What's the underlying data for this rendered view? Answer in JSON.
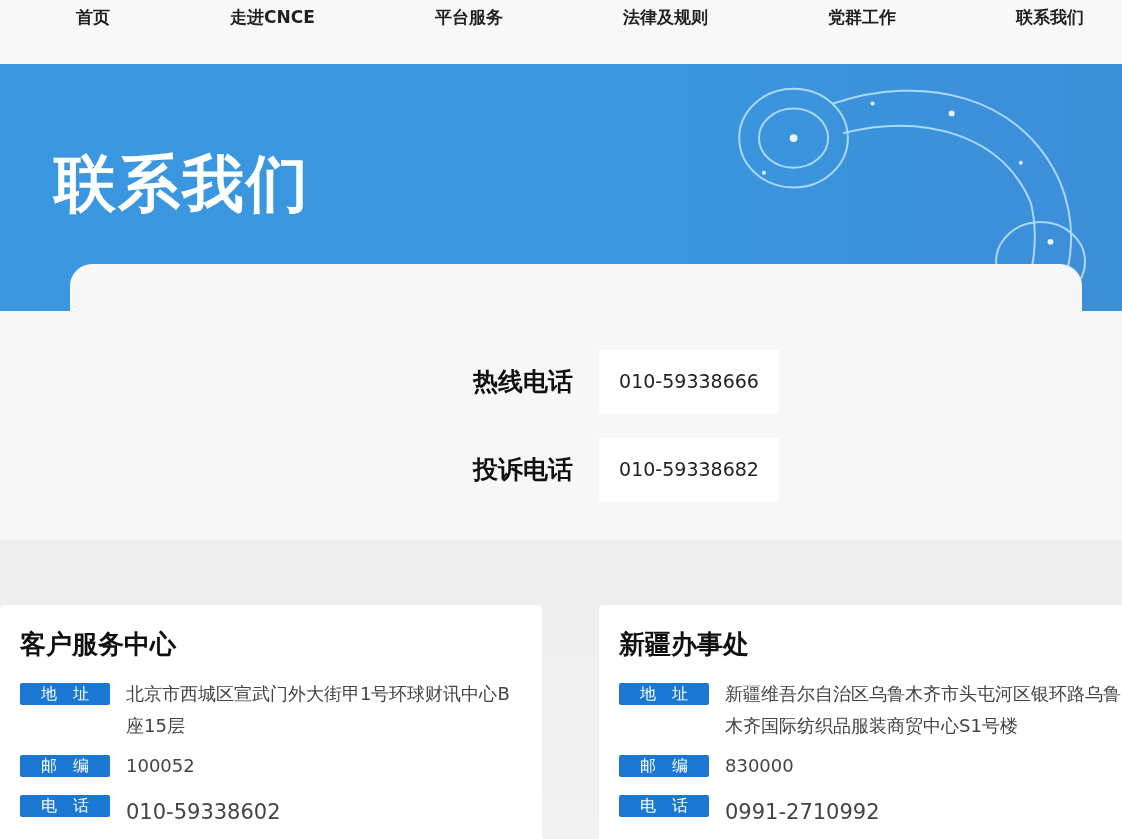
{
  "nav": [
    {
      "label": "首页"
    },
    {
      "label": "走进CNCE"
    },
    {
      "label": "平台服务"
    },
    {
      "label": "法律及规则"
    },
    {
      "label": "党群工作"
    },
    {
      "label": "联系我们"
    }
  ],
  "banner": {
    "title": "联系我们"
  },
  "hotlines": [
    {
      "label": "热线电话",
      "number": "010-59338666"
    },
    {
      "label": "投诉电话",
      "number": "010-59338682"
    }
  ],
  "offices": [
    {
      "name": "客户服务中心",
      "fields": [
        {
          "label": "地址",
          "value": "北京市西城区宣武门外大街甲1号环球财讯中心B座15层"
        },
        {
          "label": "邮编",
          "value": "100052"
        },
        {
          "label": "电话",
          "value": "010-59338602"
        }
      ]
    },
    {
      "name": "新疆办事处",
      "fields": [
        {
          "label": "地址",
          "value": "新疆维吾尔自治区乌鲁木齐市头屯河区银环路乌鲁木齐国际纺织品服装商贸中心S1号楼"
        },
        {
          "label": "邮编",
          "value": "830000"
        },
        {
          "label": "电话",
          "value": "0991-2710992"
        }
      ]
    }
  ]
}
